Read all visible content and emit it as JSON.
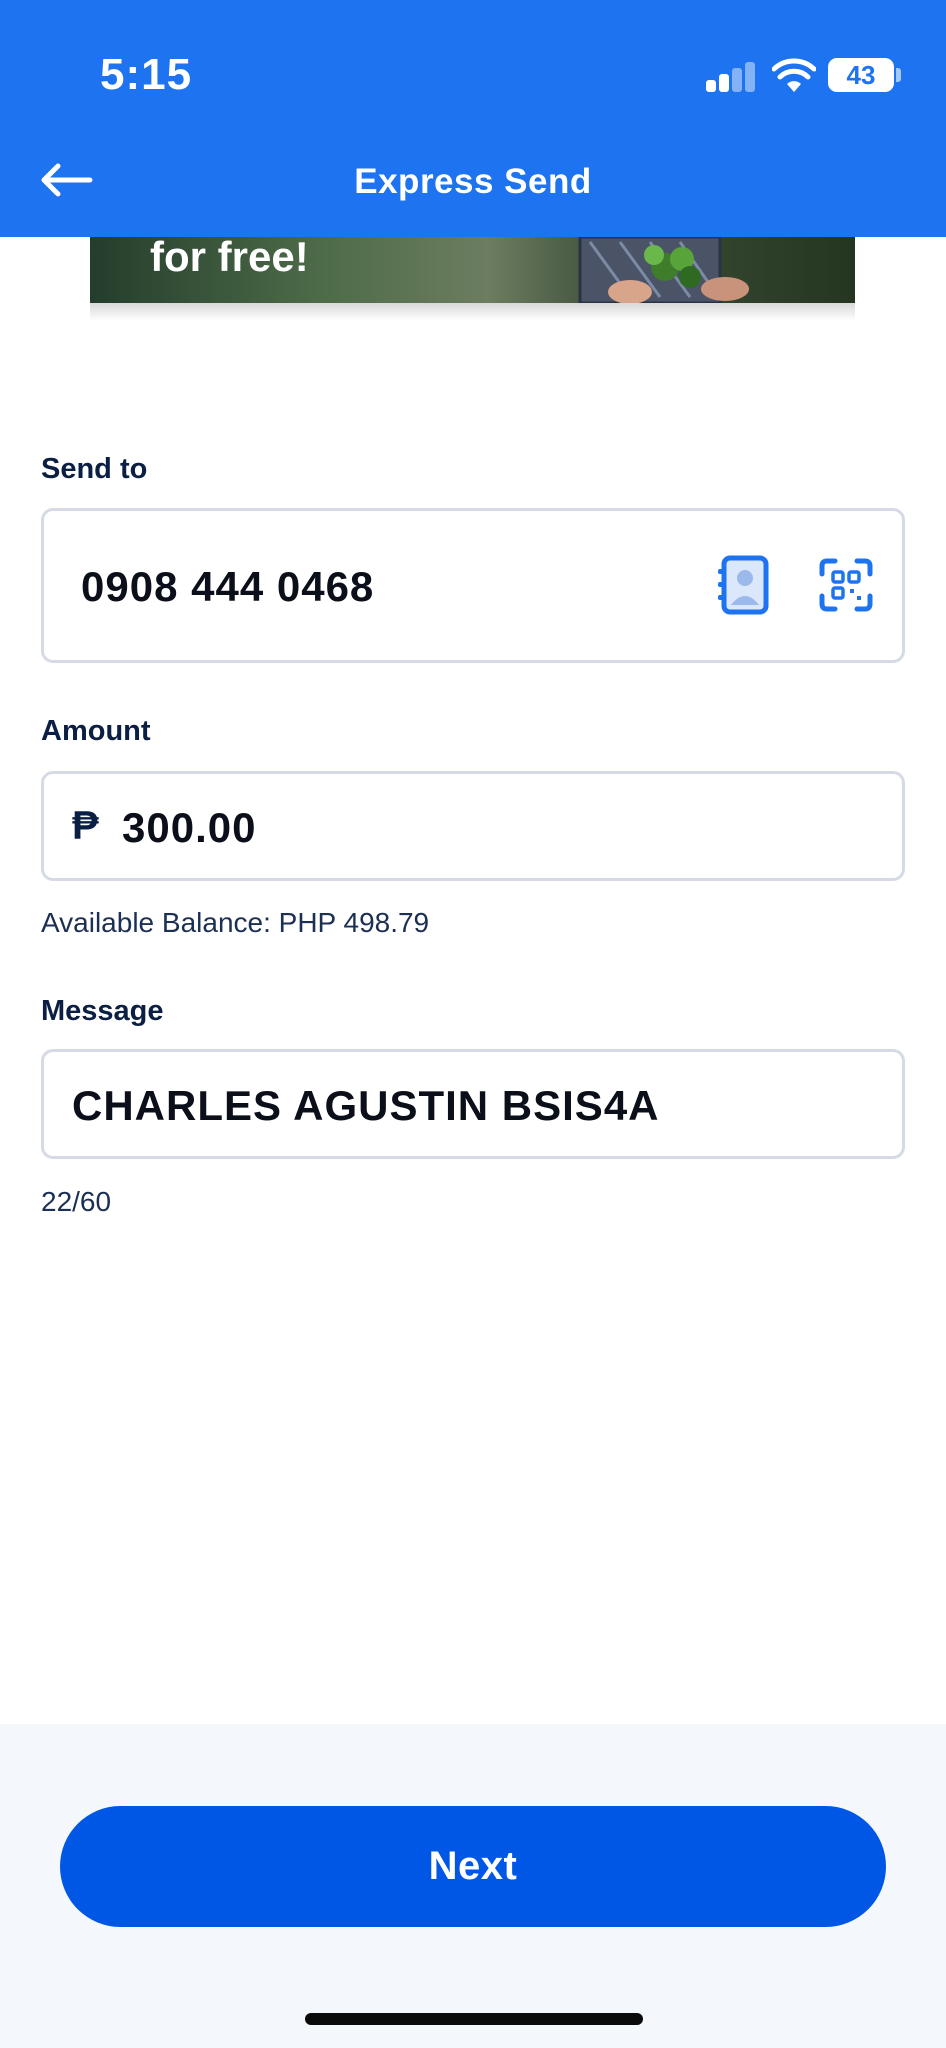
{
  "status_bar": {
    "time": "5:15",
    "battery": "43"
  },
  "header": {
    "title": "Express Send"
  },
  "banner": {
    "text": "for free!"
  },
  "form": {
    "send_to": {
      "label": "Send to",
      "value": "0908 444 0468"
    },
    "amount": {
      "label": "Amount",
      "currency_symbol": "₱",
      "value": "300.00",
      "helper": "Available Balance: PHP 498.79"
    },
    "message": {
      "label": "Message",
      "value": "CHARLES AGUSTIN BSIS4A",
      "counter": "22/60"
    }
  },
  "footer": {
    "next_label": "Next"
  },
  "icons": {
    "back": "arrow-left-icon",
    "contacts": "contact-book-icon",
    "scan": "qr-scan-icon",
    "signal": "cellular-signal-icon",
    "wifi": "wifi-icon",
    "battery": "battery-icon"
  },
  "colors": {
    "primary": "#1e73f0",
    "button": "#0057e6",
    "text": "#0b1f44"
  }
}
